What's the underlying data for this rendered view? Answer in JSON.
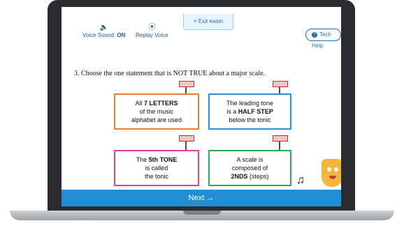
{
  "exit_label": "× Exit exam",
  "voice": {
    "label": "Voice Sound:",
    "value": "ON",
    "icon": "speaker-icon"
  },
  "replay": {
    "label": "Replay Voice",
    "icon": "play-icon"
  },
  "tech_help": {
    "label": "Tech Help",
    "icon": "question-icon"
  },
  "question": "3. Choose the one statement that is NOT TRUE about a major scale.",
  "options": [
    {
      "line1": "All ",
      "bold1": "7 LETTERS",
      "line2": "of the music",
      "line3": "alphabet are used"
    },
    {
      "line1": "The leading tone",
      "pre": "is a ",
      "bold": "HALF STEP",
      "line3": "below the tonic"
    },
    {
      "pre": "The ",
      "bold": "5th TONE",
      "line2": "is called",
      "line3": "the tonic"
    },
    {
      "line1": "A scale is",
      "line2": "composed of",
      "bold": "2NDS",
      "post": " (steps)"
    }
  ],
  "next_label": "Next →"
}
